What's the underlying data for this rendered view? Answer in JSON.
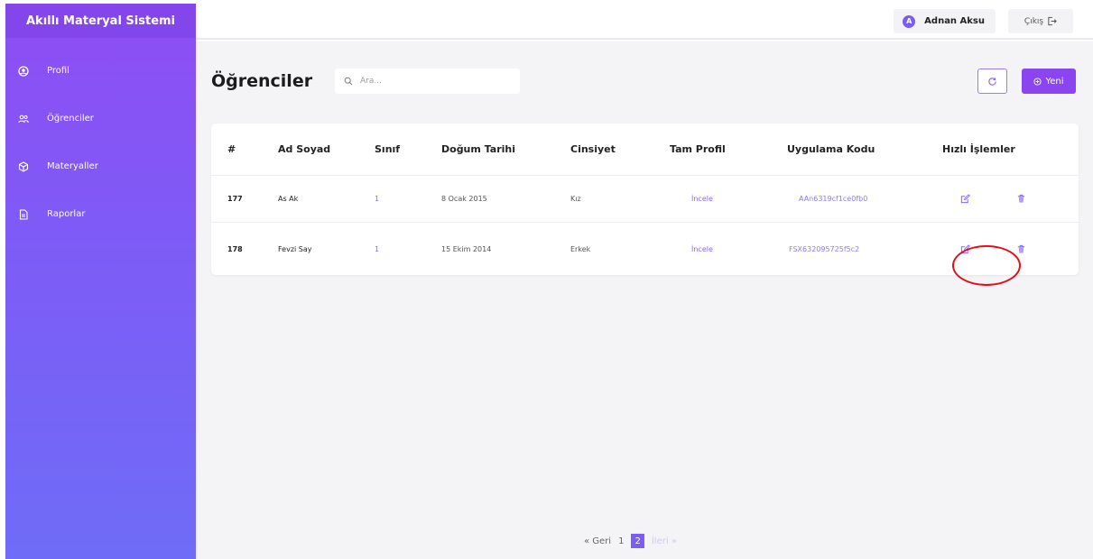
{
  "app": {
    "title": "Akıllı Materyal Sistemi"
  },
  "sidebar": {
    "items": [
      {
        "label": "Profil",
        "icon": "user-circle-icon"
      },
      {
        "label": "Öğrenciler",
        "icon": "users-icon"
      },
      {
        "label": "Materyaller",
        "icon": "cube-icon"
      },
      {
        "label": "Raporlar",
        "icon": "document-icon"
      }
    ]
  },
  "topbar": {
    "user_initial": "A",
    "user_name": "Adnan Aksu",
    "logout_label": "Çıkış"
  },
  "main": {
    "title": "Öğrenciler",
    "search_placeholder": "Ara...",
    "new_label": "Yeni"
  },
  "table": {
    "headers": [
      "#",
      "Ad Soyad",
      "Sınıf",
      "Doğum Tarihi",
      "Cinsiyet",
      "Tam Profil",
      "Uygulama Kodu",
      "Hızlı İşlemler"
    ],
    "rows": [
      {
        "id": "177",
        "name": "As Ak",
        "class": "1",
        "birth": "8 Ocak 2015",
        "gender": "Kız",
        "profile": "İncele",
        "code": "AAn6319cf1ce0fb0"
      },
      {
        "id": "178",
        "name": "Fevzi Say",
        "class": "1",
        "birth": "15 Ekim 2014",
        "gender": "Erkek",
        "profile": "İncele",
        "code": "FSX632095725f5c2"
      }
    ]
  },
  "pagination": {
    "prev": "« Geri",
    "pages": [
      "1",
      "2"
    ],
    "current": "2",
    "next": "İleri »"
  },
  "colors": {
    "accent": "#8b45f0",
    "sidebar_top": "#8e4df3",
    "sidebar_bottom": "#6f6cf7",
    "highlight": "#e0101a"
  }
}
